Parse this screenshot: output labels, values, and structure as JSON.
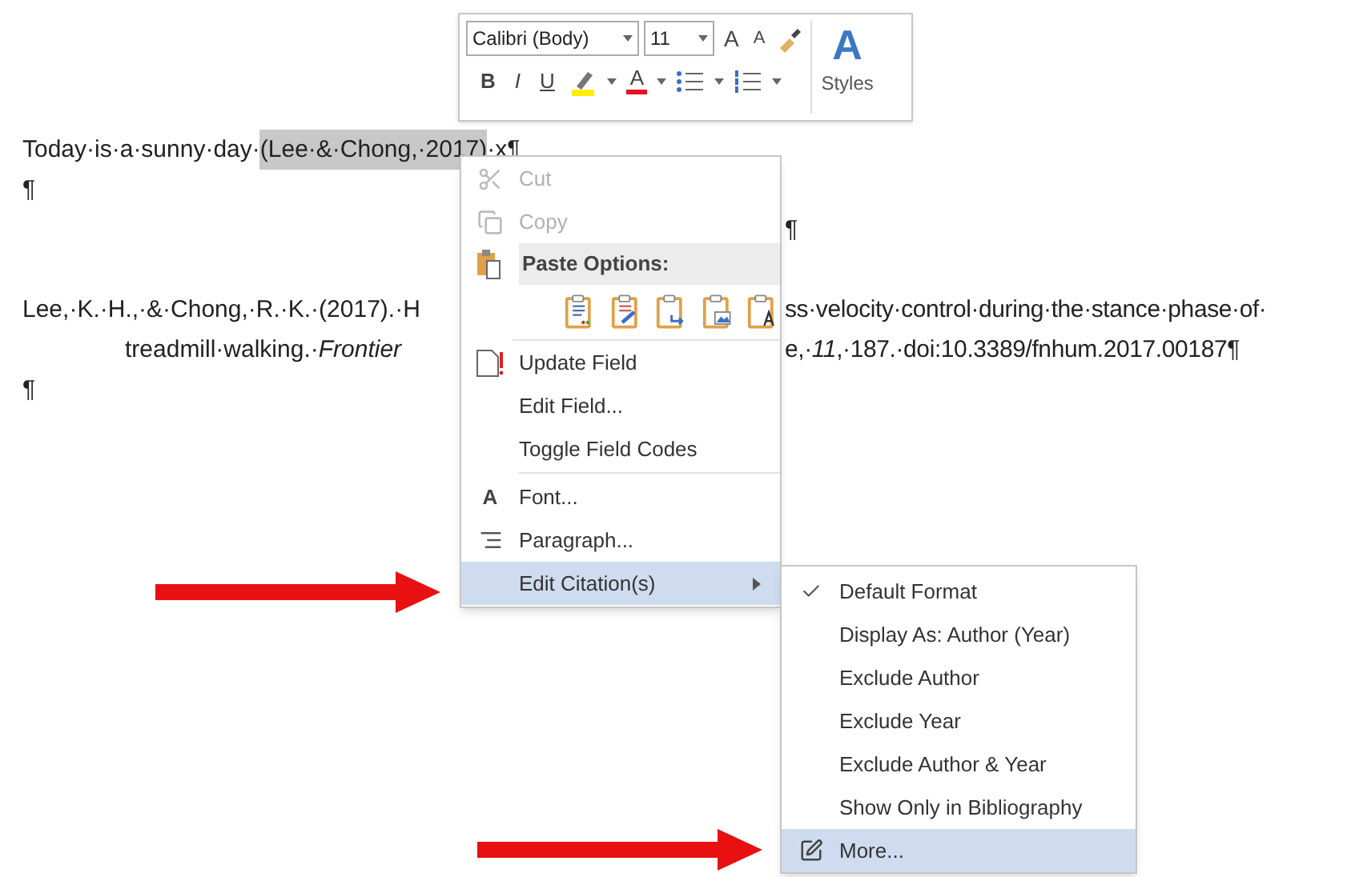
{
  "mini_toolbar": {
    "font_name": "Calibri (Body)",
    "font_size": "11",
    "grow_font": "A",
    "shrink_font": "A",
    "format_buttons": [
      "B",
      "I",
      "U"
    ],
    "font_color_glyph": "A",
    "styles_glyph": "A",
    "styles_label": "Styles"
  },
  "document": {
    "lines": [
      {
        "left": "Today·is·a·sunny·day·",
        "field": "(Lee·&·Chong,·2017)",
        "field_highlighted": true,
        "after": "·x¶"
      },
      {
        "left": "¶"
      },
      {
        "right": "¶"
      },
      {
        "space_before": true,
        "left": "Lee,·K.·H.,·&·Chong,·R.·K.·(2017).·H",
        "right": "ss·velocity·control·during·the·stance·phase·of·"
      },
      {
        "left": "treadmill·walking.·*Frontier*",
        "indent": true,
        "right": "e,·*11*,·187.·doi:10.3389/fnhum.2017.00187¶"
      },
      {
        "left": "¶"
      }
    ]
  },
  "context_menu": {
    "items": [
      {
        "kind": "command",
        "label": "Cut",
        "disabled": true,
        "selected": false
      },
      {
        "kind": "command",
        "label": "Copy",
        "disabled": true,
        "selected": false
      },
      {
        "kind": "header",
        "label": "Paste Options:"
      },
      {
        "kind": "paste_options"
      },
      {
        "kind": "command",
        "label": "Update Field",
        "disabled": false,
        "selected": false
      },
      {
        "kind": "command",
        "label": "Edit Field...",
        "disabled": false,
        "selected": false
      },
      {
        "kind": "command",
        "label": "Toggle Field Codes",
        "disabled": false,
        "selected": false
      },
      {
        "kind": "separator"
      },
      {
        "kind": "command",
        "label": "Font...",
        "glyph": "A",
        "disabled": false,
        "selected": false
      },
      {
        "kind": "command",
        "label": "Paragraph...",
        "disabled": false,
        "selected": false
      },
      {
        "kind": "submenu",
        "label": "Edit Citation(s)",
        "disabled": false,
        "selected": true
      }
    ]
  },
  "citation_submenu": {
    "items": [
      {
        "kind": "option",
        "label": "Default Format",
        "checked": true,
        "selected": false
      },
      {
        "kind": "option",
        "label": "Display As: Author (Year)",
        "checked": false,
        "selected": false
      },
      {
        "kind": "option",
        "label": "Exclude Author",
        "checked": false,
        "selected": false
      },
      {
        "kind": "option",
        "label": "Exclude Year",
        "checked": false,
        "selected": false
      },
      {
        "kind": "option",
        "label": "Exclude Author & Year",
        "checked": false,
        "selected": false
      },
      {
        "kind": "option",
        "label": "Show Only in Bibliography",
        "checked": false,
        "selected": false
      },
      {
        "kind": "command",
        "label": "More...",
        "checked": false,
        "selected": true
      }
    ]
  }
}
